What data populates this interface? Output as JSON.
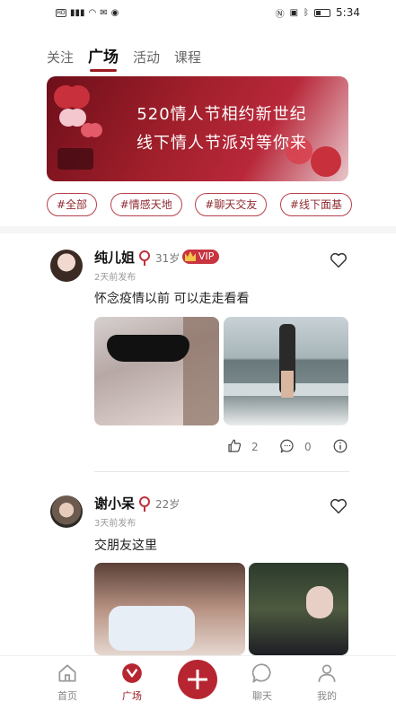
{
  "statusbar": {
    "time": "5:34",
    "network": "HD"
  },
  "tabs": [
    {
      "label": "关注",
      "active": false
    },
    {
      "label": "广场",
      "active": true
    },
    {
      "label": "活动",
      "active": false
    },
    {
      "label": "课程",
      "active": false
    }
  ],
  "banner": {
    "line1": "520情人节相约新世纪",
    "line2": "线下情人节派对等你来"
  },
  "chips": [
    "#全部",
    "#情感天地",
    "#聊天交友",
    "#线下面基"
  ],
  "posts": [
    {
      "username": "纯儿姐",
      "age": "31岁",
      "vip": "VIP",
      "time": "2天前发布",
      "text": "怀念疫情以前 可以走走看看",
      "likes": "2",
      "comments": "0"
    },
    {
      "username": "谢小呆",
      "age": "22岁",
      "time": "3天前发布",
      "text": "交朋友这里"
    }
  ],
  "nav": [
    {
      "label": "首页",
      "icon": "home-icon"
    },
    {
      "label": "广场",
      "icon": "square-icon"
    },
    {
      "label": "",
      "icon": "plus-icon"
    },
    {
      "label": "聊天",
      "icon": "chat-icon"
    },
    {
      "label": "我的",
      "icon": "profile-icon"
    }
  ],
  "colors": {
    "accent": "#9b1b22",
    "chip_border": "#b7424b",
    "banner": "#a3202c"
  }
}
